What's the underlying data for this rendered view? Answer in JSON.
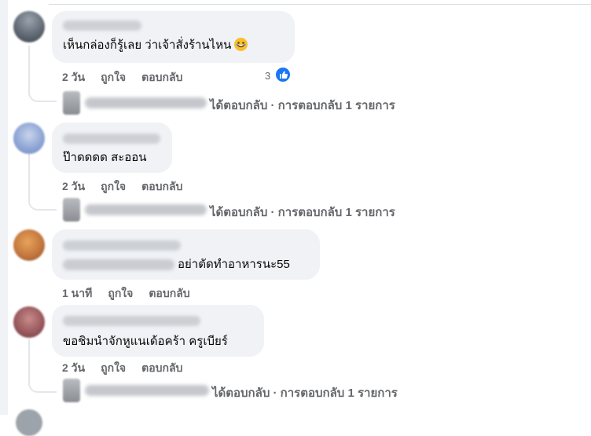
{
  "comments": [
    {
      "text": "เห็นกล่องก็รู้เลย ว่าเจ้าสั่งร้านไหน",
      "emoji": "rolling-laughing-emoji",
      "time": "2 วัน",
      "like_label": "ถูกใจ",
      "reply_label": "ตอบกลับ",
      "reaction_count": "3",
      "reply_summary": "ได้ตอบกลับ · การตอบกลับ 1 รายการ"
    },
    {
      "text": "ป๊าดดดด สะออน",
      "time": "2 วัน",
      "like_label": "ถูกใจ",
      "reply_label": "ตอบกลับ",
      "reply_summary": "ได้ตอบกลับ · การตอบกลับ 1 รายการ"
    },
    {
      "text": "อย่าตัดทำอาหารนะ55",
      "time": "1 นาที",
      "like_label": "ถูกใจ",
      "reply_label": "ตอบกลับ"
    },
    {
      "text": "ขอชิมนำจักหูแนเด้อคร้า ครูเบียร์",
      "time": "2 วัน",
      "like_label": "ถูกใจ",
      "reply_label": "ตอบกลับ",
      "reply_summary": "ได้ตอบกลับ · การตอบกลับ 1 รายการ"
    }
  ],
  "colors": {
    "bubble": "#f0f2f5",
    "meta_text": "#65676b",
    "like_blue": "#1877f2"
  }
}
